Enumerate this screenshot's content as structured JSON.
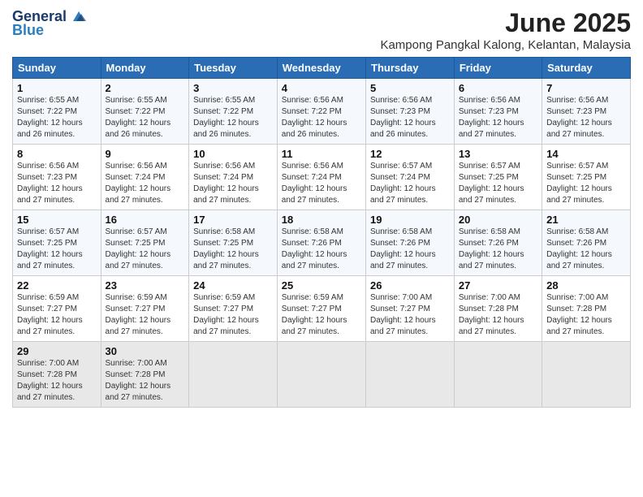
{
  "logo": {
    "general": "General",
    "blue": "Blue"
  },
  "title": "June 2025",
  "location": "Kampong Pangkal Kalong, Kelantan, Malaysia",
  "weekdays": [
    "Sunday",
    "Monday",
    "Tuesday",
    "Wednesday",
    "Thursday",
    "Friday",
    "Saturday"
  ],
  "weeks": [
    [
      {
        "day": "1",
        "sunrise": "6:55 AM",
        "sunset": "7:22 PM",
        "daylight": "12 hours and 26 minutes."
      },
      {
        "day": "2",
        "sunrise": "6:55 AM",
        "sunset": "7:22 PM",
        "daylight": "12 hours and 26 minutes."
      },
      {
        "day": "3",
        "sunrise": "6:55 AM",
        "sunset": "7:22 PM",
        "daylight": "12 hours and 26 minutes."
      },
      {
        "day": "4",
        "sunrise": "6:56 AM",
        "sunset": "7:22 PM",
        "daylight": "12 hours and 26 minutes."
      },
      {
        "day": "5",
        "sunrise": "6:56 AM",
        "sunset": "7:23 PM",
        "daylight": "12 hours and 26 minutes."
      },
      {
        "day": "6",
        "sunrise": "6:56 AM",
        "sunset": "7:23 PM",
        "daylight": "12 hours and 27 minutes."
      },
      {
        "day": "7",
        "sunrise": "6:56 AM",
        "sunset": "7:23 PM",
        "daylight": "12 hours and 27 minutes."
      }
    ],
    [
      {
        "day": "8",
        "sunrise": "6:56 AM",
        "sunset": "7:23 PM",
        "daylight": "12 hours and 27 minutes."
      },
      {
        "day": "9",
        "sunrise": "6:56 AM",
        "sunset": "7:24 PM",
        "daylight": "12 hours and 27 minutes."
      },
      {
        "day": "10",
        "sunrise": "6:56 AM",
        "sunset": "7:24 PM",
        "daylight": "12 hours and 27 minutes."
      },
      {
        "day": "11",
        "sunrise": "6:56 AM",
        "sunset": "7:24 PM",
        "daylight": "12 hours and 27 minutes."
      },
      {
        "day": "12",
        "sunrise": "6:57 AM",
        "sunset": "7:24 PM",
        "daylight": "12 hours and 27 minutes."
      },
      {
        "day": "13",
        "sunrise": "6:57 AM",
        "sunset": "7:25 PM",
        "daylight": "12 hours and 27 minutes."
      },
      {
        "day": "14",
        "sunrise": "6:57 AM",
        "sunset": "7:25 PM",
        "daylight": "12 hours and 27 minutes."
      }
    ],
    [
      {
        "day": "15",
        "sunrise": "6:57 AM",
        "sunset": "7:25 PM",
        "daylight": "12 hours and 27 minutes."
      },
      {
        "day": "16",
        "sunrise": "6:57 AM",
        "sunset": "7:25 PM",
        "daylight": "12 hours and 27 minutes."
      },
      {
        "day": "17",
        "sunrise": "6:58 AM",
        "sunset": "7:25 PM",
        "daylight": "12 hours and 27 minutes."
      },
      {
        "day": "18",
        "sunrise": "6:58 AM",
        "sunset": "7:26 PM",
        "daylight": "12 hours and 27 minutes."
      },
      {
        "day": "19",
        "sunrise": "6:58 AM",
        "sunset": "7:26 PM",
        "daylight": "12 hours and 27 minutes."
      },
      {
        "day": "20",
        "sunrise": "6:58 AM",
        "sunset": "7:26 PM",
        "daylight": "12 hours and 27 minutes."
      },
      {
        "day": "21",
        "sunrise": "6:58 AM",
        "sunset": "7:26 PM",
        "daylight": "12 hours and 27 minutes."
      }
    ],
    [
      {
        "day": "22",
        "sunrise": "6:59 AM",
        "sunset": "7:27 PM",
        "daylight": "12 hours and 27 minutes."
      },
      {
        "day": "23",
        "sunrise": "6:59 AM",
        "sunset": "7:27 PM",
        "daylight": "12 hours and 27 minutes."
      },
      {
        "day": "24",
        "sunrise": "6:59 AM",
        "sunset": "7:27 PM",
        "daylight": "12 hours and 27 minutes."
      },
      {
        "day": "25",
        "sunrise": "6:59 AM",
        "sunset": "7:27 PM",
        "daylight": "12 hours and 27 minutes."
      },
      {
        "day": "26",
        "sunrise": "7:00 AM",
        "sunset": "7:27 PM",
        "daylight": "12 hours and 27 minutes."
      },
      {
        "day": "27",
        "sunrise": "7:00 AM",
        "sunset": "7:28 PM",
        "daylight": "12 hours and 27 minutes."
      },
      {
        "day": "28",
        "sunrise": "7:00 AM",
        "sunset": "7:28 PM",
        "daylight": "12 hours and 27 minutes."
      }
    ],
    [
      {
        "day": "29",
        "sunrise": "7:00 AM",
        "sunset": "7:28 PM",
        "daylight": "12 hours and 27 minutes."
      },
      {
        "day": "30",
        "sunrise": "7:00 AM",
        "sunset": "7:28 PM",
        "daylight": "12 hours and 27 minutes."
      },
      null,
      null,
      null,
      null,
      null
    ]
  ],
  "labels": {
    "sunrise": "Sunrise:",
    "sunset": "Sunset:",
    "daylight": "Daylight: "
  }
}
